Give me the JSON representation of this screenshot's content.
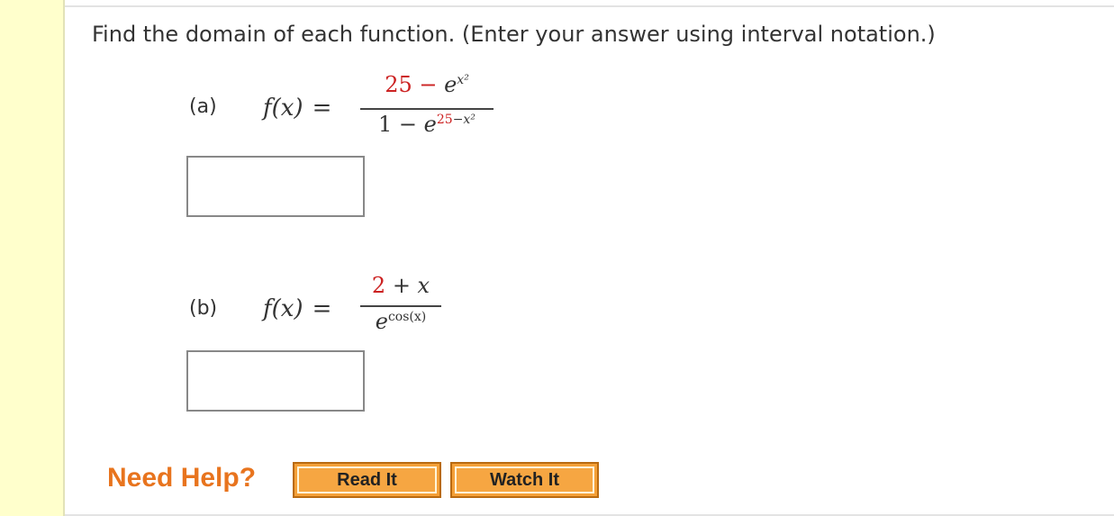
{
  "question": {
    "prompt": "Find the domain of each function. (Enter your answer using interval notation.)"
  },
  "parts": [
    {
      "label": "(a)",
      "lhs": "f(x)",
      "equals": "=",
      "numerator_const": "25 − ",
      "numerator_base": "e",
      "numerator_exp": "x²",
      "denominator_const": "1 − ",
      "denominator_base": "e",
      "denominator_exp_red": "25",
      "denominator_exp_rest": "−x²",
      "answer_value": ""
    },
    {
      "label": "(b)",
      "lhs": "f(x)",
      "equals": "=",
      "numerator_const": "2",
      "numerator_rest": " + x",
      "denominator_base": "e",
      "denominator_exp": "cos(x)",
      "answer_value": ""
    }
  ],
  "help": {
    "label": "Need Help?",
    "read_label": "Read It",
    "watch_label": "Watch It"
  },
  "colors": {
    "sidebar": "#ffffcc",
    "help_text": "#e8741e",
    "button": "#f4a038",
    "math_red": "#cc2222"
  }
}
